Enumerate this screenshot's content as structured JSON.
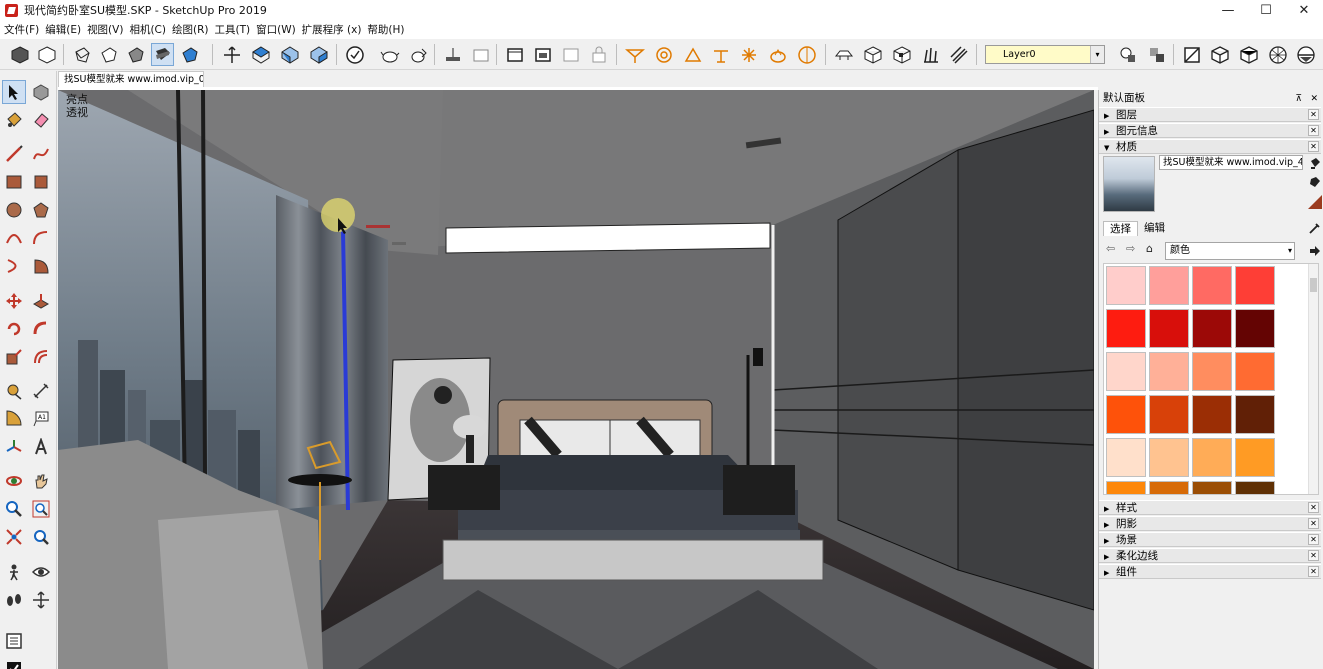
{
  "window": {
    "title": "现代简约卧室SU模型.SKP - SketchUp Pro 2019",
    "controls": [
      "—",
      "☐",
      "✕"
    ]
  },
  "menu": [
    "文件(F)",
    "编辑(E)",
    "视图(V)",
    "相机(C)",
    "绘图(R)",
    "工具(T)",
    "窗口(W)",
    "扩展程序 (x)",
    "帮助(H)"
  ],
  "toolbar": {
    "layer_value": "Layer0",
    "layer_arrow": "▾"
  },
  "document_tab": "找SU模型就来 www.imod.vip_0",
  "viewport": {
    "labels": [
      "亮点",
      "透视"
    ]
  },
  "tray": {
    "title": "默认面板",
    "pin": "⊼",
    "close": "✕",
    "collapsed_top": [
      {
        "label": "图层",
        "arrow": "▶"
      },
      {
        "label": "图元信息",
        "arrow": "▶"
      }
    ],
    "materials": {
      "label": "材质",
      "arrow": "▼",
      "material_name": "找SU模型就来 www.imod.vip_41",
      "tabs": [
        "选择",
        "编辑"
      ],
      "library": "颜色",
      "swatches": [
        [
          "#ffcdcb",
          "#ff9f9b",
          "#ff6a63",
          "#fe3e36"
        ],
        [
          "#fe1c10",
          "#d80f0b",
          "#9c0907",
          "#640403"
        ],
        [
          "#ffd6cb",
          "#ffb098",
          "#ff8d5f",
          "#ff6b32"
        ],
        [
          "#fe520a",
          "#d84109",
          "#9b2e05",
          "#612006"
        ],
        [
          "#ffe0cb",
          "#ffc390",
          "#ffac57",
          "#ff9b24"
        ],
        [
          "#fd870a",
          "#d76b08",
          "#9b4e05",
          "#5f3004"
        ]
      ]
    },
    "collapsed_bottom": [
      {
        "label": "样式",
        "arrow": "▶"
      },
      {
        "label": "阴影",
        "arrow": "▶"
      },
      {
        "label": "场景",
        "arrow": "▶"
      },
      {
        "label": "柔化边线",
        "arrow": "▶"
      },
      {
        "label": "组件",
        "arrow": "▶"
      }
    ]
  },
  "colors": {
    "accent": "#2f7fd1",
    "layer_box": "#fffbc8",
    "brand_red": "#c9221a"
  }
}
